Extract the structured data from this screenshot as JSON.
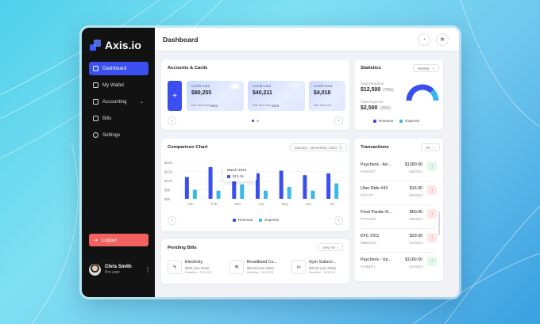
{
  "app": {
    "name": "Axis.io"
  },
  "sidebar": {
    "items": [
      {
        "label": "Dashboard"
      },
      {
        "label": "My Wallet"
      },
      {
        "label": "Accounting"
      },
      {
        "label": "Bills"
      },
      {
        "label": "Settings"
      }
    ],
    "logout_label": "Logout",
    "user": {
      "name": "Chris Smith",
      "role": "Pro user"
    }
  },
  "header": {
    "title": "Dashboard"
  },
  "accounts": {
    "title": "Accounts & Cards",
    "cards": [
      {
        "label": "Credit Card",
        "amount": "$80,255",
        "number": "**** **** **** 5022"
      },
      {
        "label": "Credit Card",
        "amount": "$40,211",
        "number": "**** **** **** 0316",
        "brand": "VISA"
      },
      {
        "label": "Credit Card",
        "amount": "$4,018",
        "number": "**** **** ****"
      }
    ]
  },
  "statistics": {
    "title": "Statistics",
    "period": "Weekly",
    "total_revenue_label": "Total Revenue",
    "total_revenue_value": "$12,500",
    "total_revenue_pct": "(75%)",
    "total_expense_label": "Total Expense",
    "total_expense_value": "$2,500",
    "total_expense_pct": "(25%)",
    "legend": [
      "Revenue",
      "Expense"
    ],
    "revenue_share": 0.75,
    "expense_share": 0.25,
    "colors": {
      "revenue": "#3b4ef0",
      "expense": "#39b8ec"
    }
  },
  "comparison": {
    "title": "Comparison Chart",
    "date_range": "January - December, 2024",
    "tooltip": {
      "title": "March 2024",
      "value": "$15.3k"
    }
  },
  "chart_data": {
    "type": "bar",
    "categories": [
      "Jan",
      "Feb",
      "Mar",
      "Apr",
      "May",
      "Jun",
      "Jul"
    ],
    "y_ticks": [
      "$20k",
      "$15k",
      "$10k",
      "$5k",
      "$0k"
    ],
    "ylim": [
      0,
      20
    ],
    "series": [
      {
        "name": "Revenue",
        "color": "#3b4ef0",
        "values": [
          12,
          17.5,
          16,
          14,
          15.5,
          13,
          14
        ]
      },
      {
        "name": "Expense",
        "color": "#39b8ec",
        "values": [
          5,
          4.5,
          8,
          4.5,
          6.5,
          4.5,
          8.5
        ]
      }
    ]
  },
  "transactions": {
    "title": "Transactions",
    "filter": "All",
    "items": [
      {
        "name": "Paycheck - Ad...",
        "id": "#ASD4XT",
        "amount": "$1380.00",
        "date": "06/03/24",
        "dir": "in"
      },
      {
        "name": "Uber Ride #43",
        "id": "#4YYYT",
        "amount": "$16.00",
        "date": "06/03/24",
        "dir": "out"
      },
      {
        "name": "Food Panda #1...",
        "id": "#TTGURT",
        "amount": "$60.00",
        "date": "05/03/24",
        "dir": "out"
      },
      {
        "name": "KFC #311",
        "id": "#BBUNGT",
        "amount": "$29.00",
        "date": "21/03/24",
        "dir": "out"
      },
      {
        "name": "Paycheck - Up...",
        "id": "#1HBDYL",
        "amount": "$1160.00",
        "date": "21/03/24",
        "dir": "in"
      }
    ]
  },
  "bills": {
    "title": "Pending Bills",
    "view_all": "View All",
    "items": [
      {
        "name": "Electricity",
        "price": "$320 (Jan 2024)",
        "deadline": "Deadline - 25/12/23"
      },
      {
        "name": "Broadband Co...",
        "price": "$22.50 (Jan 2024)",
        "deadline": "Deadline - 25/12/23"
      },
      {
        "name": "Gym Subscri...",
        "price": "$35.00 (Jan 2024)",
        "deadline": "Deadline - 25/12/23"
      }
    ]
  }
}
